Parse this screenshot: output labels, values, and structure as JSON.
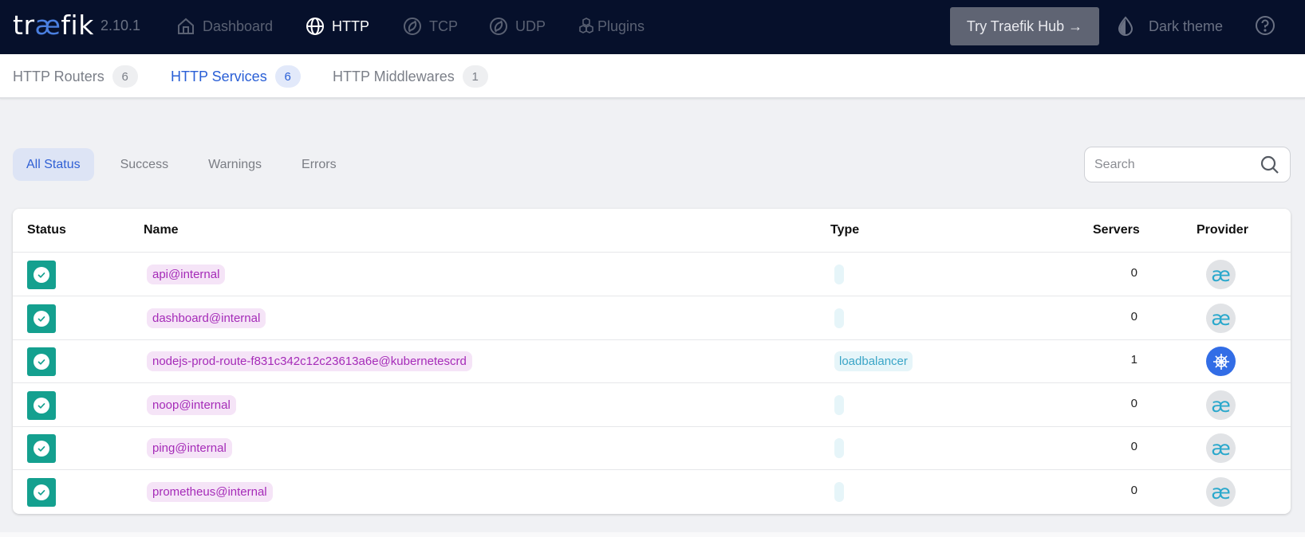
{
  "app": {
    "logo_prefix": "tr",
    "logo_mid": "æ",
    "logo_suffix": "fik",
    "version": "2.10.1"
  },
  "topnav": {
    "items": [
      {
        "label": "Dashboard",
        "icon": "home-icon",
        "active": false
      },
      {
        "label": "HTTP",
        "icon": "globe-icon",
        "active": true
      },
      {
        "label": "TCP",
        "icon": "tcp-icon",
        "active": false
      },
      {
        "label": "UDP",
        "icon": "udp-icon",
        "active": false
      },
      {
        "label": "Plugins",
        "icon": "plugins-cubes-icon",
        "active": false
      }
    ],
    "hub_button": "Try Traefik Hub →",
    "theme_label": "Dark theme",
    "help_icon": "help-circle-icon"
  },
  "subnav": {
    "tabs": [
      {
        "label": "HTTP Routers",
        "count": "6",
        "active": false
      },
      {
        "label": "HTTP Services",
        "count": "6",
        "active": true
      },
      {
        "label": "HTTP Middlewares",
        "count": "1",
        "active": false
      }
    ]
  },
  "filters": {
    "items": [
      {
        "label": "All Status",
        "active": true
      },
      {
        "label": "Success",
        "active": false
      },
      {
        "label": "Warnings",
        "active": false
      },
      {
        "label": "Errors",
        "active": false
      }
    ]
  },
  "search": {
    "placeholder": "Search",
    "value": ""
  },
  "table": {
    "columns": [
      "Status",
      "Name",
      "Type",
      "Servers",
      "Provider"
    ],
    "rows": [
      {
        "status": "success",
        "name": "api@internal",
        "type": "",
        "servers": "0",
        "provider": "internal",
        "provider_glyph": "æ"
      },
      {
        "status": "success",
        "name": "dashboard@internal",
        "type": "",
        "servers": "0",
        "provider": "internal",
        "provider_glyph": "æ"
      },
      {
        "status": "success",
        "name": "nodejs-prod-route-f831c342c12c23613a6e@kubernetescrd",
        "type": "loadbalancer",
        "servers": "1",
        "provider": "kubernetes",
        "provider_glyph": ""
      },
      {
        "status": "success",
        "name": "noop@internal",
        "type": "",
        "servers": "0",
        "provider": "internal",
        "provider_glyph": "æ"
      },
      {
        "status": "success",
        "name": "ping@internal",
        "type": "",
        "servers": "0",
        "provider": "internal",
        "provider_glyph": "æ"
      },
      {
        "status": "success",
        "name": "prometheus@internal",
        "type": "",
        "servers": "0",
        "provider": "internal",
        "provider_glyph": "æ"
      }
    ]
  },
  "colors": {
    "topbar_bg": "#06102b",
    "accent_blue": "#2a5fd6",
    "success_green": "#14a08f",
    "name_chip_text": "#a52bb8",
    "type_chip_text": "#3aa5c7",
    "kubernetes_blue": "#326de6"
  }
}
